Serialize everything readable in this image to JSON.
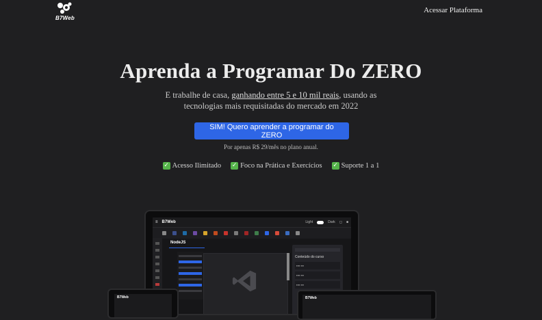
{
  "header": {
    "logo_text": "B7Web",
    "nav_link": "Acessar Plataforma"
  },
  "hero": {
    "title": "Aprenda a Programar Do ZERO",
    "subtitle_pre": "E trabalhe de casa, ",
    "subtitle_link": "ganhando entre 5 e 10 mil reais",
    "subtitle_post": ", usando as",
    "subtitle_line2": "tecnologias mais requisitadas do mercado em 2022",
    "cta_label": "SIM! Quero aprender a programar do ZERO",
    "price_note": "Por apenas R$ 29/mês no plano anual."
  },
  "features": [
    {
      "icon": "check-icon",
      "label": "Acesso Ilimitado"
    },
    {
      "icon": "check-icon",
      "label": "Foco na Prática e Exercícios"
    },
    {
      "icon": "check-icon",
      "label": "Suporte 1 a 1"
    }
  ],
  "mockup": {
    "brand": "B7Web",
    "course_title": "NodeJS",
    "light_label": "Light",
    "dark_label": "Dark",
    "panel_title": "Conteúdo do curso"
  },
  "colors": {
    "background": "#1f1f21",
    "accent": "#2e66e6",
    "check": "#55b44a"
  }
}
